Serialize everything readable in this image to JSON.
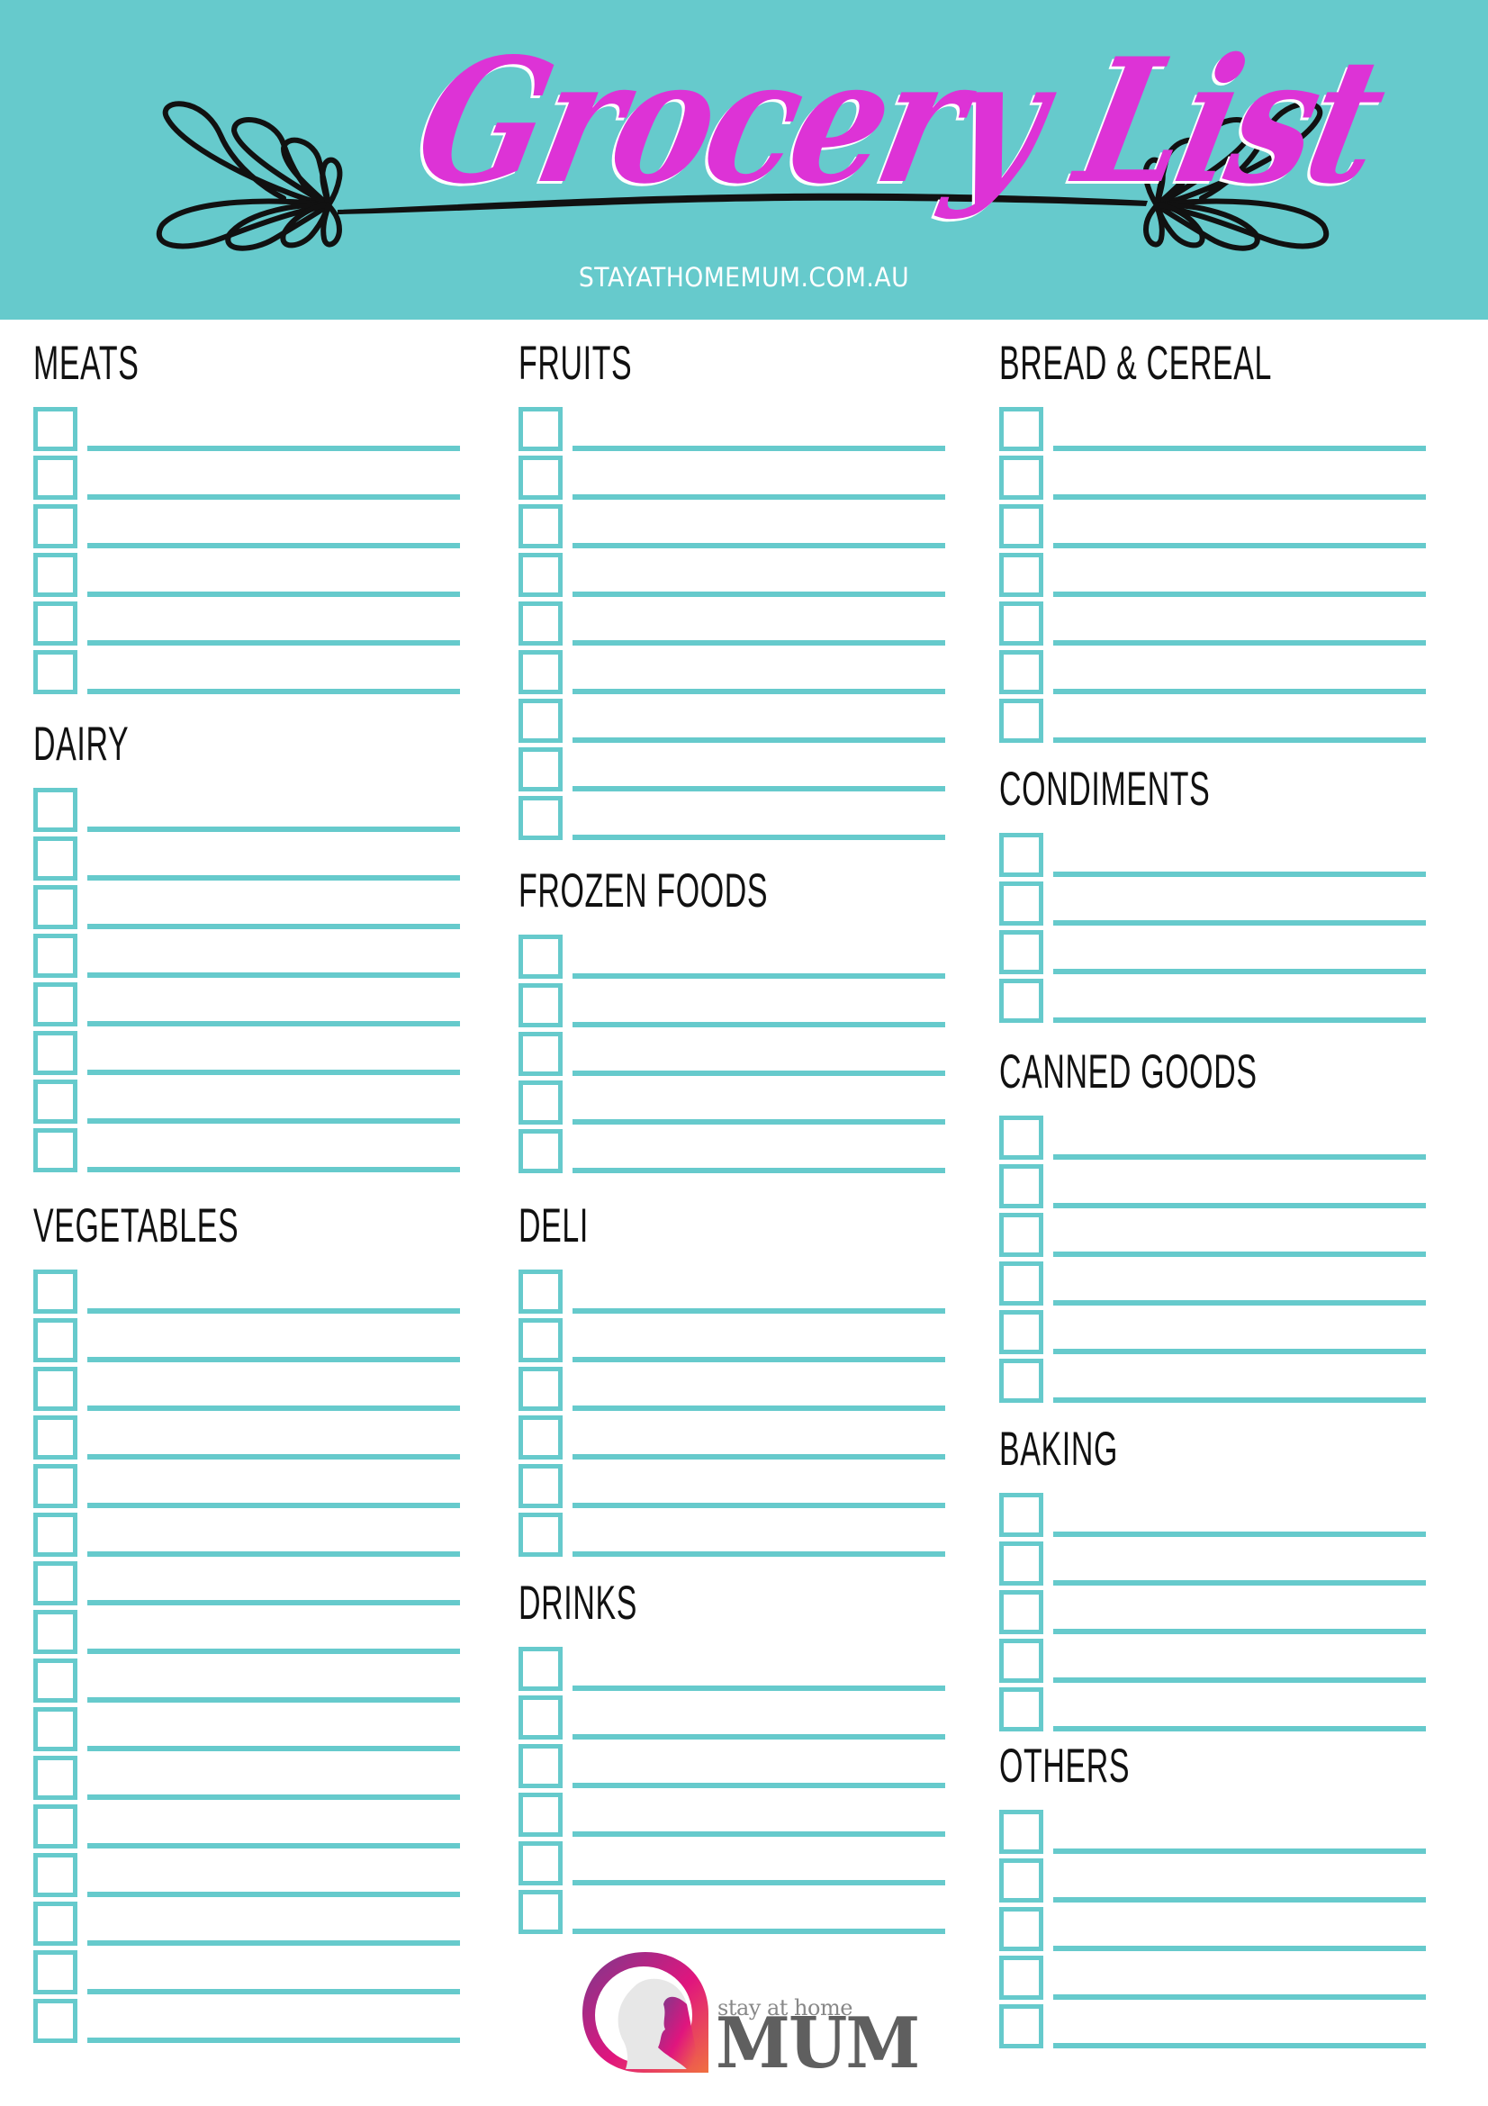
{
  "header": {
    "title": "Grocery List",
    "website": "STAYATHOMEMUM.COM.AU",
    "background_color": "#66cacc",
    "title_color": "#dd33d6"
  },
  "columns": [
    {
      "sections": [
        {
          "key": "meats",
          "title": "MEATS",
          "rows": 6
        },
        {
          "key": "dairy",
          "title": "DAIRY",
          "rows": 8
        },
        {
          "key": "vegetables",
          "title": "VEGETABLES",
          "rows": 16
        }
      ]
    },
    {
      "sections": [
        {
          "key": "fruits",
          "title": "FRUITS",
          "rows": 9
        },
        {
          "key": "frozen",
          "title": "FROZEN FOODS",
          "rows": 5
        },
        {
          "key": "deli",
          "title": "DELI",
          "rows": 6
        },
        {
          "key": "drinks",
          "title": "DRINKS",
          "rows": 6
        }
      ]
    },
    {
      "sections": [
        {
          "key": "bread",
          "title": "BREAD & CEREAL",
          "rows": 7
        },
        {
          "key": "condiments",
          "title": "CONDIMENTS",
          "rows": 4
        },
        {
          "key": "canned",
          "title": "CANNED GOODS",
          "rows": 6
        },
        {
          "key": "baking",
          "title": "BAKING",
          "rows": 5
        },
        {
          "key": "others",
          "title": "OTHERS",
          "rows": 5
        }
      ]
    }
  ],
  "checklist": {
    "accent_color": "#66cacc",
    "checkbox_state": "unchecked",
    "item_value": ""
  },
  "footer": {
    "logo_small_text": "stay at home",
    "logo_big_text": "MUM"
  }
}
